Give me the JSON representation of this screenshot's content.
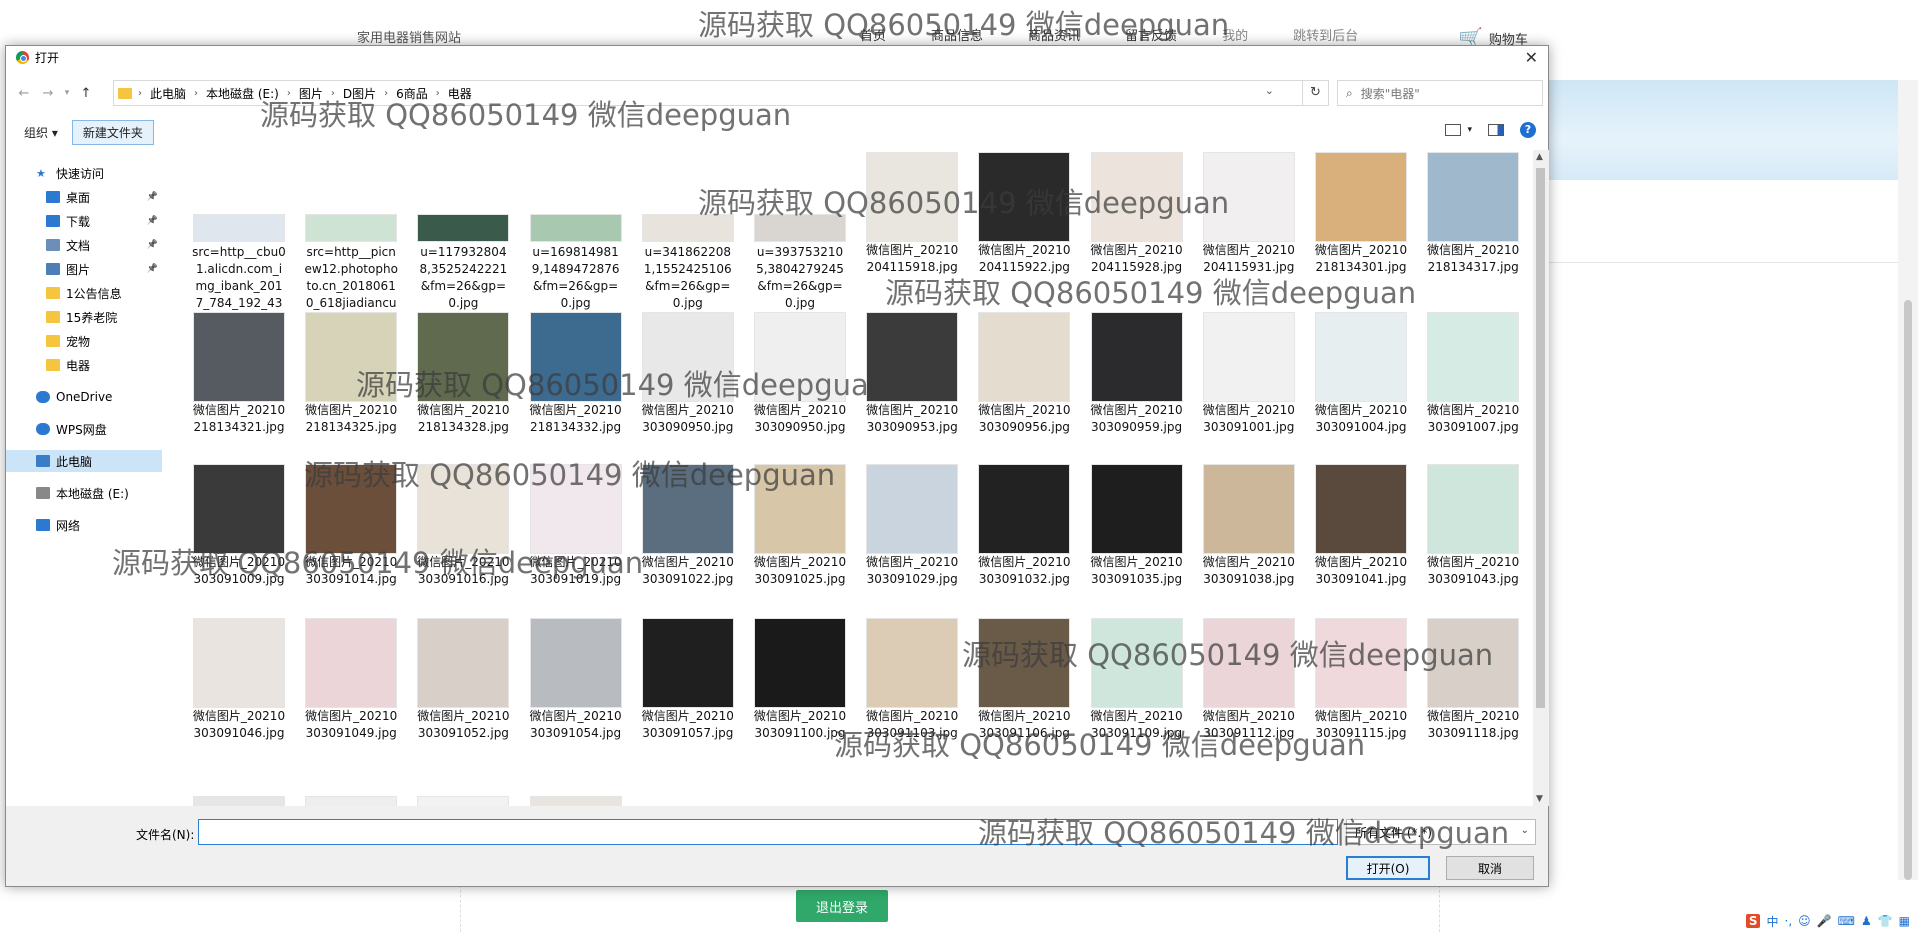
{
  "site": {
    "brand": "家用电器销售网站",
    "nav": [
      "首页",
      "商品信息",
      "商品资讯",
      "留言反馈",
      "我的",
      "跳转到后台"
    ],
    "cart": "购物车",
    "logout": "退出登录"
  },
  "dialog": {
    "title": "打开",
    "breadcrumb": [
      "此电脑",
      "本地磁盘 (E:)",
      "图片",
      "D图片",
      "6商品",
      "电器"
    ],
    "search_placeholder": "搜索\"电器\"",
    "organize": "组织 ▾",
    "new_folder": "新建文件夹",
    "sidebar": [
      {
        "label": "快速访问",
        "icon": "star-icon",
        "pinned": false
      },
      {
        "label": "桌面",
        "icon": "desktop-icon",
        "pinned": true
      },
      {
        "label": "下载",
        "icon": "download-icon",
        "pinned": true
      },
      {
        "label": "文档",
        "icon": "document-icon",
        "pinned": true
      },
      {
        "label": "图片",
        "icon": "picture-icon",
        "pinned": true
      },
      {
        "label": "1公告信息",
        "icon": "folder-icon",
        "pinned": false
      },
      {
        "label": "15养老院",
        "icon": "folder-icon",
        "pinned": false
      },
      {
        "label": "宠物",
        "icon": "folder-icon",
        "pinned": false
      },
      {
        "label": "电器",
        "icon": "folder-icon",
        "pinned": false
      },
      {
        "label": "OneDrive",
        "icon": "cloud-icon",
        "pinned": false
      },
      {
        "label": "WPS网盘",
        "icon": "cloud-icon",
        "pinned": false
      },
      {
        "label": "此电脑",
        "icon": "computer-icon",
        "pinned": false
      },
      {
        "label": "本地磁盘 (E:)",
        "icon": "drive-icon",
        "pinned": false
      },
      {
        "label": "网络",
        "icon": "network-icon",
        "pinned": false
      }
    ],
    "files": [
      {
        "name": "src=http__cbu01.alicdn.com_img_ibank_2017_784_192_43662...",
        "color": "#dfe6ee"
      },
      {
        "name": "src=http__picnew12.photophoto.cn_20180610_618jiadiancux...",
        "color": "#cfe3d4"
      },
      {
        "name": "u=1179328048,3525242221&fm=26&gp=0.jpg",
        "color": "#3a5b4b"
      },
      {
        "name": "u=1698149819,1489472876&fm=26&gp=0.jpg",
        "color": "#a8c8b0"
      },
      {
        "name": "u=3418622081,1552425106&fm=26&gp=0.jpg",
        "color": "#e8e3dc"
      },
      {
        "name": "u=3937532105,3804279245&fm=26&gp=0.jpg",
        "color": "#d9d6d2"
      },
      {
        "name": "微信图片_20210204115918.jpg",
        "color": "#e9e5df"
      },
      {
        "name": "微信图片_20210204115922.jpg",
        "color": "#2a2a2a"
      },
      {
        "name": "微信图片_20210204115928.jpg",
        "color": "#ece4dc"
      },
      {
        "name": "微信图片_20210204115931.jpg",
        "color": "#f1eff0"
      },
      {
        "name": "微信图片_20210218134301.jpg",
        "color": "#d9b07b"
      },
      {
        "name": "微信图片_20210218134317.jpg",
        "color": "#9fb8cc"
      },
      {
        "name": "微信图片_20210218134321.jpg",
        "color": "#555b60"
      },
      {
        "name": "微信图片_20210218134325.jpg",
        "color": "#d7d3b8"
      },
      {
        "name": "微信图片_20210218134328.jpg",
        "color": "#5f6a4f"
      },
      {
        "name": "微信图片_20210218134332.jpg",
        "color": "#3d6a8f"
      },
      {
        "name": "微信图片_20210303090950.jpg",
        "color": "#e8e8e8"
      },
      {
        "name": "微信图片_20210303090950.jpg",
        "color": "#efefef"
      },
      {
        "name": "微信图片_20210303090953.jpg",
        "color": "#3b3b3b"
      },
      {
        "name": "微信图片_20210303090956.jpg",
        "color": "#e3dccf"
      },
      {
        "name": "微信图片_20210303090959.jpg",
        "color": "#2b2b2e"
      },
      {
        "name": "微信图片_20210303091001.jpg",
        "color": "#f1f1f1"
      },
      {
        "name": "微信图片_20210303091004.jpg",
        "color": "#e6eef0"
      },
      {
        "name": "微信图片_20210303091007.jpg",
        "color": "#d6ebe3"
      },
      {
        "name": "微信图片_20210303091009.jpg",
        "color": "#3a3a3a"
      },
      {
        "name": "微信图片_20210303091014.jpg",
        "color": "#6b4f3a"
      },
      {
        "name": "微信图片_20210303091016.jpg",
        "color": "#e8e2d8"
      },
      {
        "name": "微信图片_20210303091019.jpg",
        "color": "#f0e8ec"
      },
      {
        "name": "微信图片_20210303091022.jpg",
        "color": "#5a6e7f"
      },
      {
        "name": "微信图片_20210303091025.jpg",
        "color": "#d8c6a8"
      },
      {
        "name": "微信图片_20210303091029.jpg",
        "color": "#c9d4de"
      },
      {
        "name": "微信图片_20210303091032.jpg",
        "color": "#222222"
      },
      {
        "name": "微信图片_20210303091035.jpg",
        "color": "#1e1e1e"
      },
      {
        "name": "微信图片_20210303091038.jpg",
        "color": "#cdb79a"
      },
      {
        "name": "微信图片_20210303091041.jpg",
        "color": "#5a4a3d"
      },
      {
        "name": "微信图片_20210303091043.jpg",
        "color": "#cfe6dc"
      },
      {
        "name": "微信图片_20210303091046.jpg",
        "color": "#e9e4e0"
      },
      {
        "name": "微信图片_20210303091049.jpg",
        "color": "#ecd5d8"
      },
      {
        "name": "微信图片_20210303091052.jpg",
        "color": "#d8d0c8"
      },
      {
        "name": "微信图片_20210303091054.jpg",
        "color": "#b8bcc0"
      },
      {
        "name": "微信图片_20210303091057.jpg",
        "color": "#1f1f1f"
      },
      {
        "name": "微信图片_20210303091100.jpg",
        "color": "#1a1a1a"
      },
      {
        "name": "微信图片_20210303091103.jpg",
        "color": "#dcccb5"
      },
      {
        "name": "微信图片_20210303091106.jpg",
        "color": "#6a5a48"
      },
      {
        "name": "微信图片_20210303091109.jpg",
        "color": "#cfe6dc"
      },
      {
        "name": "微信图片_20210303091112.jpg",
        "color": "#ecd5d8"
      },
      {
        "name": "微信图片_20210303091115.jpg",
        "color": "#efd9dc"
      },
      {
        "name": "微信图片_20210303091118.jpg",
        "color": "#d8d0c8"
      }
    ],
    "filename_label": "文件名(N):",
    "filename_value": "",
    "filetype": "所有文件 (*.*)",
    "open_button": "打开(O)",
    "cancel_button": "取消"
  },
  "watermark": "源码获取 QQ86050149 微信deepguan"
}
